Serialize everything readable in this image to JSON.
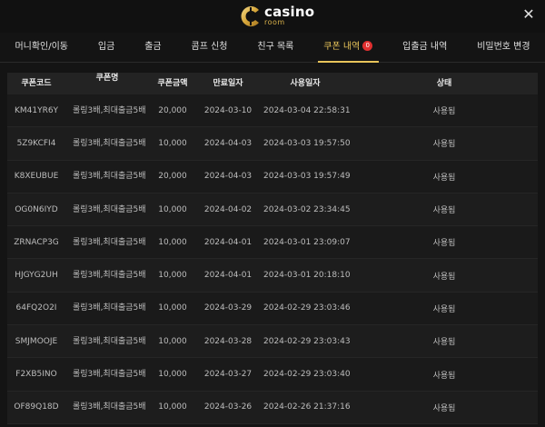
{
  "brand": {
    "name": "casino",
    "sub": "room"
  },
  "close_label": "✕",
  "tabs": [
    {
      "label": "머니확인/이동"
    },
    {
      "label": "입금"
    },
    {
      "label": "출금"
    },
    {
      "label": "콤프 신청"
    },
    {
      "label": "친구 목록"
    },
    {
      "label": "쿠폰 내역",
      "badge": "0"
    },
    {
      "label": "입출금 내역"
    },
    {
      "label": "비밀번호 변경"
    }
  ],
  "table": {
    "headers": [
      "쿠폰코드",
      "쿠폰명",
      "쿠폰금액",
      "만료일자",
      "사용일자",
      "상태"
    ],
    "rows": [
      [
        "KM41YR6Y",
        "롤링3배,최대출금5배",
        "20,000",
        "2024-03-10",
        "2024-03-04 22:58:31",
        "사용됨"
      ],
      [
        "5Z9KCFI4",
        "롤링3배,최대출금5배",
        "10,000",
        "2024-04-03",
        "2024-03-03 19:57:50",
        "사용됨"
      ],
      [
        "K8XEUBUE",
        "롤링3배,최대출금5배",
        "20,000",
        "2024-04-03",
        "2024-03-03 19:57:49",
        "사용됨"
      ],
      [
        "OG0N6IYD",
        "롤링3배,최대출금5배",
        "10,000",
        "2024-04-02",
        "2024-03-02 23:34:45",
        "사용됨"
      ],
      [
        "ZRNACP3G",
        "롤링3배,최대출금5배",
        "10,000",
        "2024-04-01",
        "2024-03-01 23:09:07",
        "사용됨"
      ],
      [
        "HJGYG2UH",
        "롤링3배,최대출금5배",
        "10,000",
        "2024-04-01",
        "2024-03-01 20:18:10",
        "사용됨"
      ],
      [
        "64FQ2O2I",
        "롤링3배,최대출금5배",
        "10,000",
        "2024-03-29",
        "2024-02-29 23:03:46",
        "사용됨"
      ],
      [
        "SMJMOOJE",
        "롤링3배,최대출금5배",
        "10,000",
        "2024-03-28",
        "2024-02-29 23:03:43",
        "사용됨"
      ],
      [
        "F2XB5INO",
        "롤링3배,최대출금5배",
        "10,000",
        "2024-03-27",
        "2024-02-29 23:03:40",
        "사용됨"
      ],
      [
        "OF89Q18D",
        "롤링3배,최대출금5배",
        "10,000",
        "2024-03-26",
        "2024-02-26 21:37:16",
        "사용됨"
      ]
    ]
  }
}
